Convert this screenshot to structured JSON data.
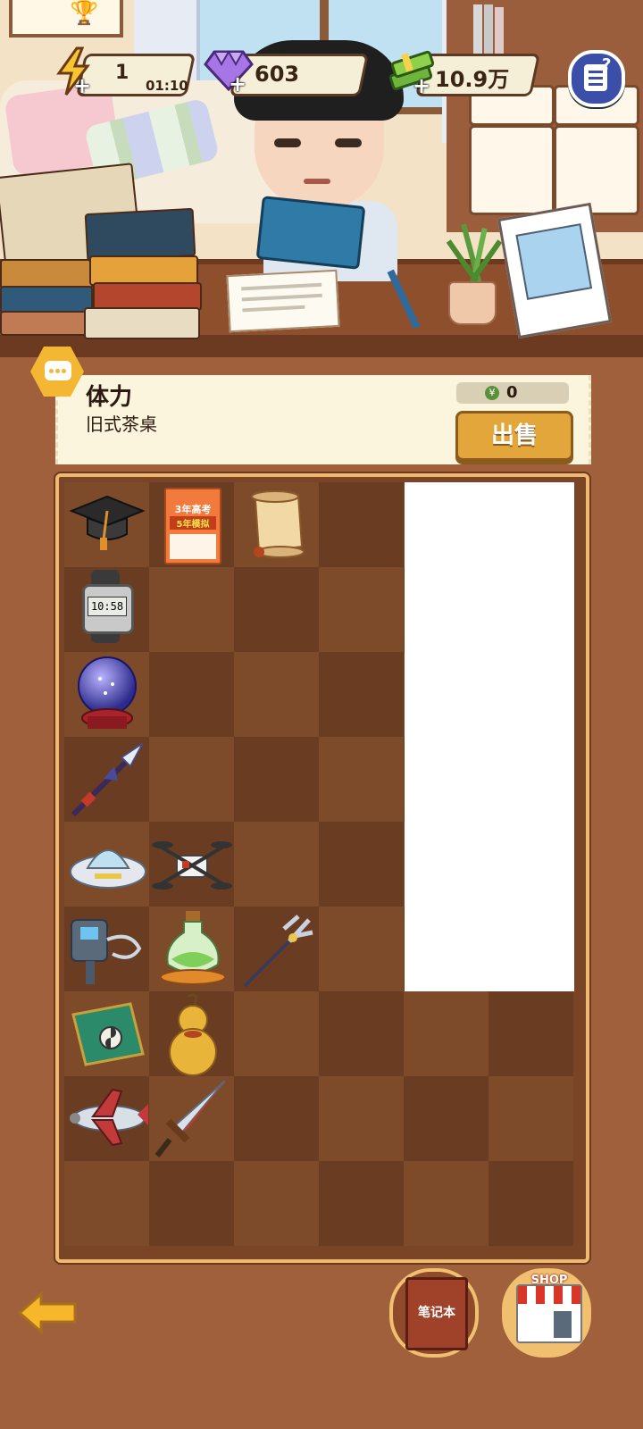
{
  "hud": {
    "energy": {
      "value": "1",
      "timer": "01:10",
      "icon": "lightning-icon"
    },
    "gems": {
      "value": "603",
      "icon": "gem-icon"
    },
    "cash": {
      "value": "10.9万",
      "icon": "money-stack-icon"
    },
    "help_icon": "task-list-icon"
  },
  "item_panel": {
    "title": "体力",
    "subtitle": "旧式茶桌",
    "price": "0",
    "coin_symbol": "¥",
    "sell_label": "出售"
  },
  "inventory": {
    "columns": 6,
    "rows": 9,
    "items": [
      {
        "row": 0,
        "col": 0,
        "name": "graduation-cap-icon"
      },
      {
        "row": 0,
        "col": 1,
        "name": "exam-book-icon",
        "text_line1": "3年高考",
        "text_line2": "5年模拟"
      },
      {
        "row": 0,
        "col": 2,
        "name": "scroll-icon"
      },
      {
        "row": 1,
        "col": 0,
        "name": "digital-watch-icon",
        "text": "10:58"
      },
      {
        "row": 2,
        "col": 0,
        "name": "crystal-ball-icon"
      },
      {
        "row": 3,
        "col": 0,
        "name": "spear-icon"
      },
      {
        "row": 4,
        "col": 0,
        "name": "ufo-icon"
      },
      {
        "row": 4,
        "col": 1,
        "name": "drone-icon"
      },
      {
        "row": 5,
        "col": 0,
        "name": "hammer-icon"
      },
      {
        "row": 5,
        "col": 1,
        "name": "potion-bottle-icon"
      },
      {
        "row": 5,
        "col": 2,
        "name": "trident-icon"
      },
      {
        "row": 6,
        "col": 0,
        "name": "magic-scroll-icon"
      },
      {
        "row": 6,
        "col": 1,
        "name": "gourd-icon"
      },
      {
        "row": 7,
        "col": 0,
        "name": "airplane-icon"
      },
      {
        "row": 7,
        "col": 1,
        "name": "sword-icon"
      }
    ]
  },
  "bottom": {
    "back_icon": "back-arrow-icon",
    "notebook_label": "笔记本",
    "shop_label": "SHOP"
  },
  "colors": {
    "background": "#a0603c",
    "panel": "#fbf5dd",
    "sell_button": "#e3a63b",
    "grid_dark": "#6a3c22",
    "grid_light": "#7d4a2a"
  }
}
